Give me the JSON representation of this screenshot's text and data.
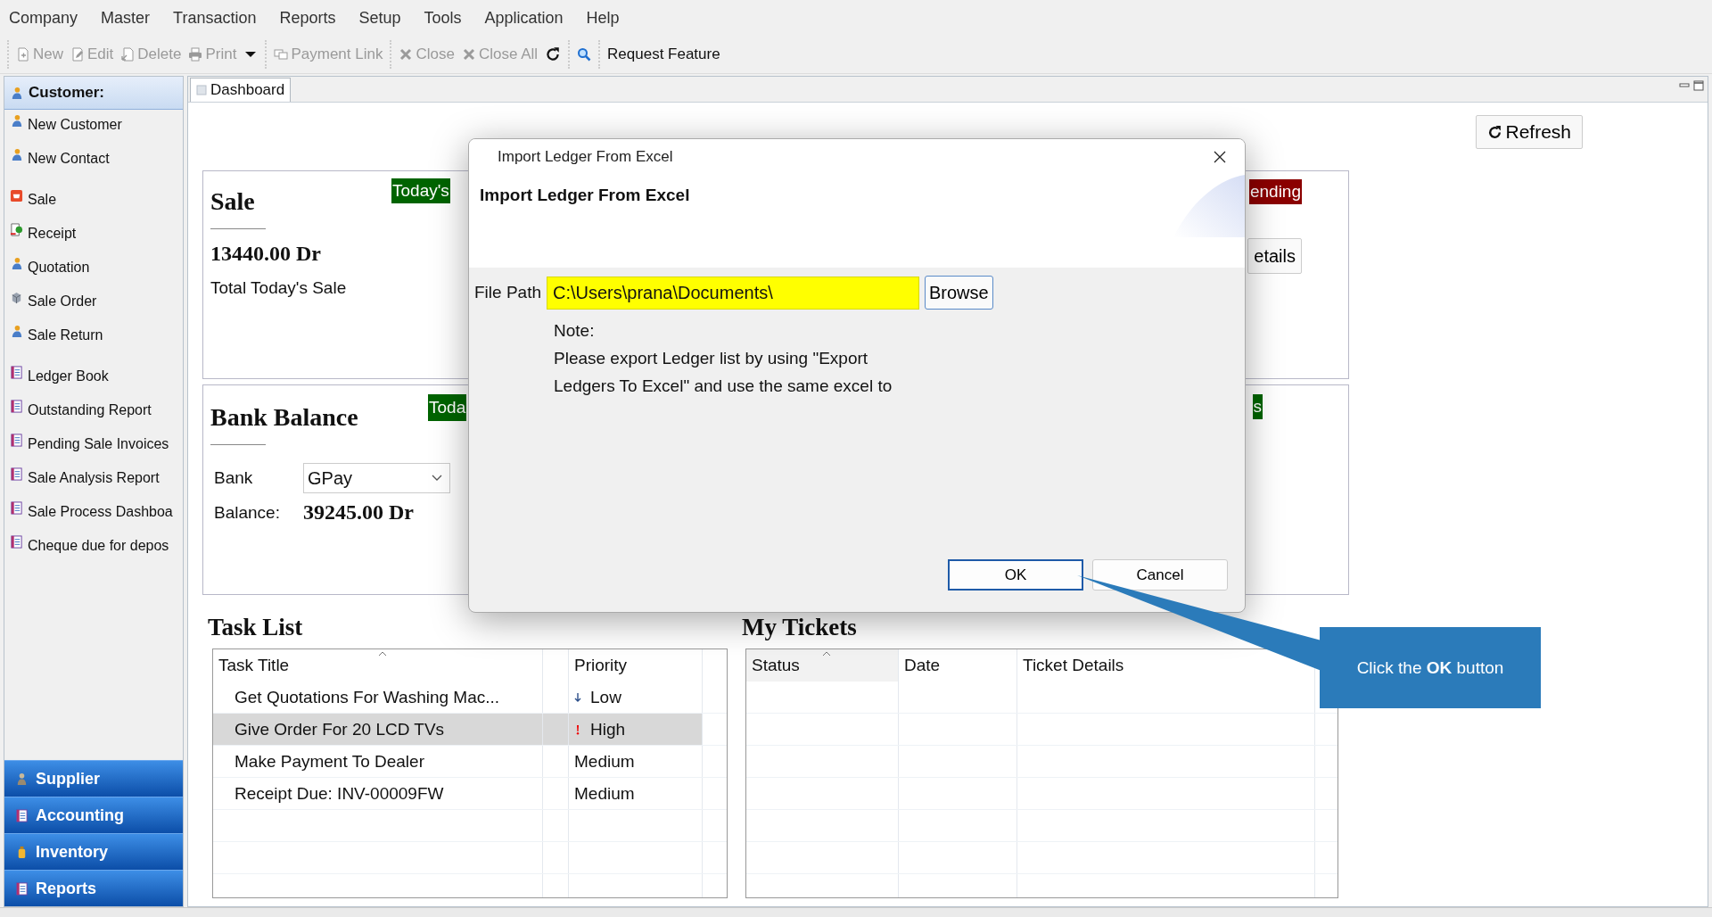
{
  "menu": [
    "Company",
    "Master",
    "Transaction",
    "Reports",
    "Setup",
    "Tools",
    "Application",
    "Help"
  ],
  "toolbar": [
    [
      {
        "kind": "new",
        "label": "New",
        "disabled": true
      },
      {
        "kind": "edit",
        "label": "Edit",
        "disabled": true
      },
      {
        "kind": "delete",
        "label": "Delete",
        "disabled": true
      },
      {
        "kind": "print",
        "label": "Print",
        "disabled": true
      },
      {
        "kind": "caret",
        "disabled": false
      }
    ],
    [
      {
        "kind": "link",
        "label": "Payment Link",
        "disabled": true
      }
    ],
    [
      {
        "kind": "close",
        "label": "Close",
        "disabled": true
      },
      {
        "kind": "close",
        "label": "Close All",
        "disabled": true
      },
      {
        "kind": "refresh",
        "disabled": false
      }
    ],
    [
      {
        "kind": "search",
        "disabled": false
      }
    ],
    [
      {
        "kind": "text",
        "label": "Request Feature",
        "disabled": false
      }
    ]
  ],
  "sidebar": {
    "header": {
      "label": "Customer:",
      "kind": "person",
      "expanded": true
    },
    "groups": [
      [
        {
          "label": "New Customer",
          "kind": "person"
        },
        {
          "label": "New Contact",
          "kind": "person"
        }
      ],
      [
        {
          "label": "Sale",
          "kind": "sale"
        },
        {
          "label": "Receipt",
          "kind": "receipt"
        },
        {
          "label": "Quotation",
          "kind": "person"
        },
        {
          "label": "Sale Order",
          "kind": "order"
        },
        {
          "label": "Sale Return",
          "kind": "person"
        }
      ],
      [
        {
          "label": "Ledger Book",
          "kind": "report"
        },
        {
          "label": "Outstanding Report",
          "kind": "report"
        },
        {
          "label": "Pending Sale Invoices",
          "kind": "report"
        },
        {
          "label": "Sale Analysis Report",
          "kind": "report"
        },
        {
          "label": "Sale Process Dashboa",
          "kind": "report"
        },
        {
          "label": "Cheque due for depos",
          "kind": "report"
        }
      ]
    ],
    "sections": [
      {
        "label": "Supplier",
        "kind": "supplier"
      },
      {
        "label": "Accounting",
        "kind": "report"
      },
      {
        "label": "Inventory",
        "kind": "bottle"
      },
      {
        "label": "Reports",
        "kind": "report"
      }
    ]
  },
  "tab": {
    "label": "Dashboard",
    "selected": true
  },
  "refresh": "Refresh",
  "cards": [
    {
      "kind": "sale",
      "title": "Sale",
      "tag": {
        "label": "Today's",
        "color": "#006400"
      },
      "amount": "13440.00 Dr",
      "caption": "Total Today's Sale",
      "right_tag": {
        "label": "ending",
        "color": "#8b0000"
      },
      "right_button": "etails"
    },
    {
      "kind": "bank",
      "title": "Bank Balance",
      "tag": {
        "label": "Toda",
        "color": "#006400"
      },
      "bank": {
        "label": "Bank",
        "value": "GPay"
      },
      "balance": {
        "label": "Balance:",
        "value": "39245.00 Dr"
      },
      "right_tag": {
        "label": "s",
        "color": "#006400"
      }
    }
  ],
  "tasks": {
    "title": "Task List",
    "columns": [
      {
        "label": "Task Title",
        "sorted": true
      },
      {
        "label": "Priority",
        "sorted": false
      }
    ],
    "rows": [
      {
        "title": "Get Quotations For Washing Mac...",
        "priority": "Low",
        "kind": "low",
        "selected": false
      },
      {
        "title": "Give Order For 20 LCD TVs",
        "priority": "High",
        "kind": "high",
        "selected": true
      },
      {
        "title": "Make Payment To Dealer",
        "priority": "Medium",
        "kind": "medium",
        "selected": false
      },
      {
        "title": "Receipt Due: INV-00009FW",
        "priority": "Medium",
        "kind": "medium",
        "selected": false
      }
    ]
  },
  "tickets": {
    "title": "My Tickets",
    "columns": [
      {
        "label": "Status",
        "sorted": true
      },
      {
        "label": "Date",
        "sorted": false
      },
      {
        "label": "Ticket Details",
        "sorted": false
      }
    ]
  },
  "dialog": {
    "title": "Import Ledger From Excel",
    "heading": "Import Ledger From Excel",
    "file_path": {
      "label": "File Path",
      "value": "C:\\Users\\prana\\Documents\\"
    },
    "browse": "Browse",
    "note": [
      "Note:",
      "Please export Ledger list by using \"Export",
      "Ledgers To Excel\" and use  the same excel to"
    ],
    "buttons": [
      {
        "label": "OK",
        "default": true
      },
      {
        "label": "Cancel",
        "default": false
      }
    ]
  },
  "callout": "Click the **OK** button"
}
